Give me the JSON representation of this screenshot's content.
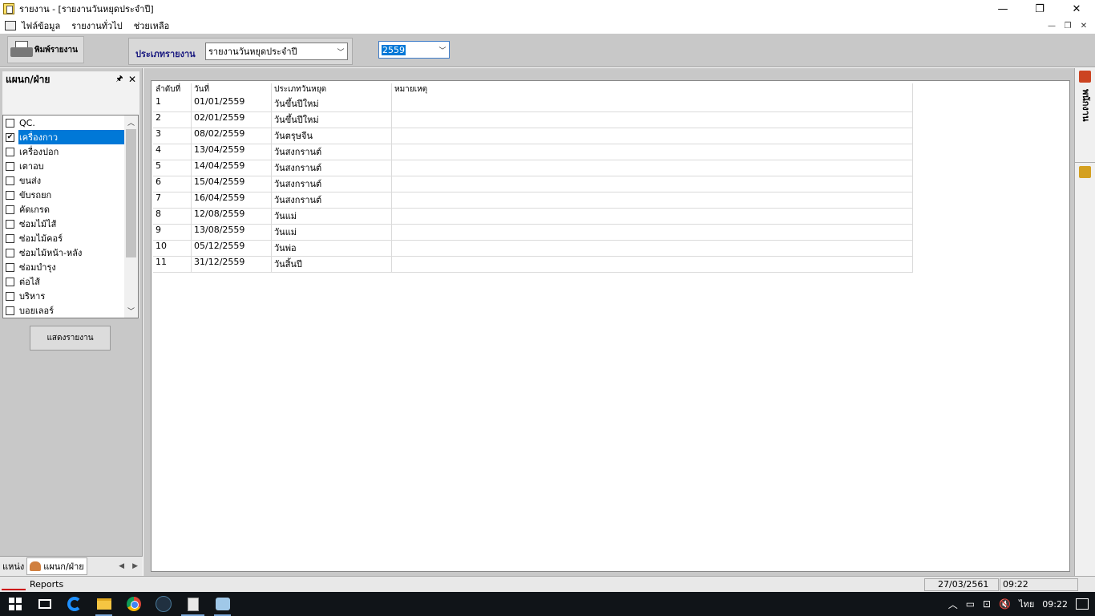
{
  "window": {
    "title": "รายงาน - [รายงานวันหยุดประจำปี]",
    "minimize": "—",
    "maximize": "❐",
    "close": "✕"
  },
  "menu": {
    "items": [
      "ไฟล์ข้อมูล",
      "รายงานทั่วไป",
      "ช่วยเหลือ"
    ],
    "mdi_minimize": "—",
    "mdi_restore": "❐",
    "mdi_close": "✕"
  },
  "toolbar": {
    "print_label": "พิมพ์รายงาน",
    "report_type_label": "ประเภทรายงาน",
    "report_type_value": "รายงานวันหยุดประจำปี",
    "year_value": "2559"
  },
  "left_panel": {
    "title": "แผนก/ฝ่าย",
    "pin": "🖈",
    "close": "✕",
    "departments": [
      {
        "label": "QC.",
        "checked": false,
        "selected": false
      },
      {
        "label": "เครื่องกาว",
        "checked": true,
        "selected": true
      },
      {
        "label": "เครื่องปอก",
        "checked": false,
        "selected": false
      },
      {
        "label": "เตาอบ",
        "checked": false,
        "selected": false
      },
      {
        "label": "ขนส่ง",
        "checked": false,
        "selected": false
      },
      {
        "label": "ขับรถยก",
        "checked": false,
        "selected": false
      },
      {
        "label": "คัดเกรด",
        "checked": false,
        "selected": false
      },
      {
        "label": "ซ่อมไม้ไส้",
        "checked": false,
        "selected": false
      },
      {
        "label": "ซ่อมไม้คอร์",
        "checked": false,
        "selected": false
      },
      {
        "label": "ซ่อมไม้หน้า-หลัง",
        "checked": false,
        "selected": false
      },
      {
        "label": "ซ่อมบำรุง",
        "checked": false,
        "selected": false
      },
      {
        "label": "ต่อไส้",
        "checked": false,
        "selected": false
      },
      {
        "label": "บริหาร",
        "checked": false,
        "selected": false
      },
      {
        "label": "บอยเลอร์",
        "checked": false,
        "selected": false
      }
    ],
    "show_report_label": "แสดงรายงาน",
    "tabs": [
      "แหน่ง",
      "แผนก/ฝ่าย"
    ]
  },
  "grid": {
    "columns": [
      "ลำดับที่",
      "วันที่",
      "ประเภทวันหยุด",
      "หมายเหตุ"
    ],
    "rows": [
      [
        "1",
        "01/01/2559",
        "วันขึ้นปีใหม่",
        ""
      ],
      [
        "2",
        "02/01/2559",
        "วันขึ้นปีใหม่",
        ""
      ],
      [
        "3",
        "08/02/2559",
        "วันตรุษจีน",
        ""
      ],
      [
        "4",
        "13/04/2559",
        "วันสงกรานต์",
        ""
      ],
      [
        "5",
        "14/04/2559",
        "วันสงกรานต์",
        ""
      ],
      [
        "6",
        "15/04/2559",
        "วันสงกรานต์",
        ""
      ],
      [
        "7",
        "16/04/2559",
        "วันสงกรานต์",
        ""
      ],
      [
        "8",
        "12/08/2559",
        "วันแม่",
        ""
      ],
      [
        "9",
        "13/08/2559",
        "วันแม่",
        ""
      ],
      [
        "10",
        "05/12/2559",
        "วันพ่อ",
        ""
      ],
      [
        "11",
        "31/12/2559",
        "วันสิ้นปี",
        ""
      ]
    ]
  },
  "right_strip": {
    "label": "พนักงาน"
  },
  "status": {
    "label": "Reports",
    "date": "27/03/2561",
    "time": "09:22"
  },
  "taskbar": {
    "language": "ไทย",
    "clock": "09:22"
  }
}
